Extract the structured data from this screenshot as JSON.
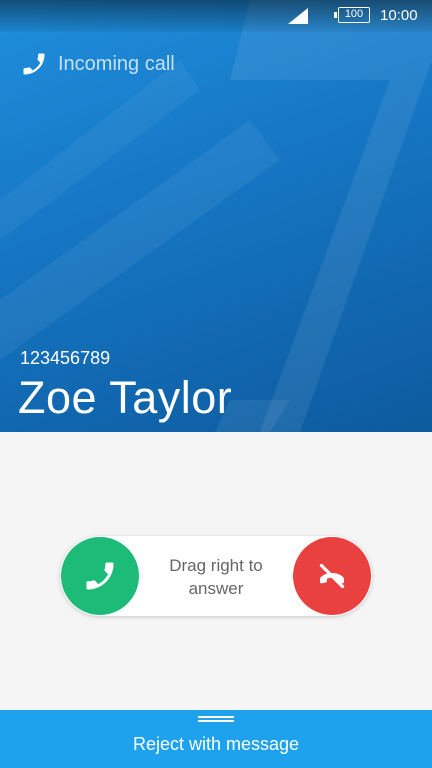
{
  "status_bar": {
    "time": "10:00",
    "battery": "100",
    "signal_icon": "signal-icon"
  },
  "call": {
    "status": "Incoming call",
    "number": "123456789",
    "name": "Zoe Taylor"
  },
  "controls": {
    "answer_icon": "phone-icon",
    "decline_icon": "end-call-icon",
    "hint": "Drag right to answer"
  },
  "reject": {
    "label": "Reject with message"
  },
  "colors": {
    "accent": "#1fa2ee",
    "answer": "#1dbb78",
    "decline": "#e94040",
    "header": "#1678c6"
  }
}
